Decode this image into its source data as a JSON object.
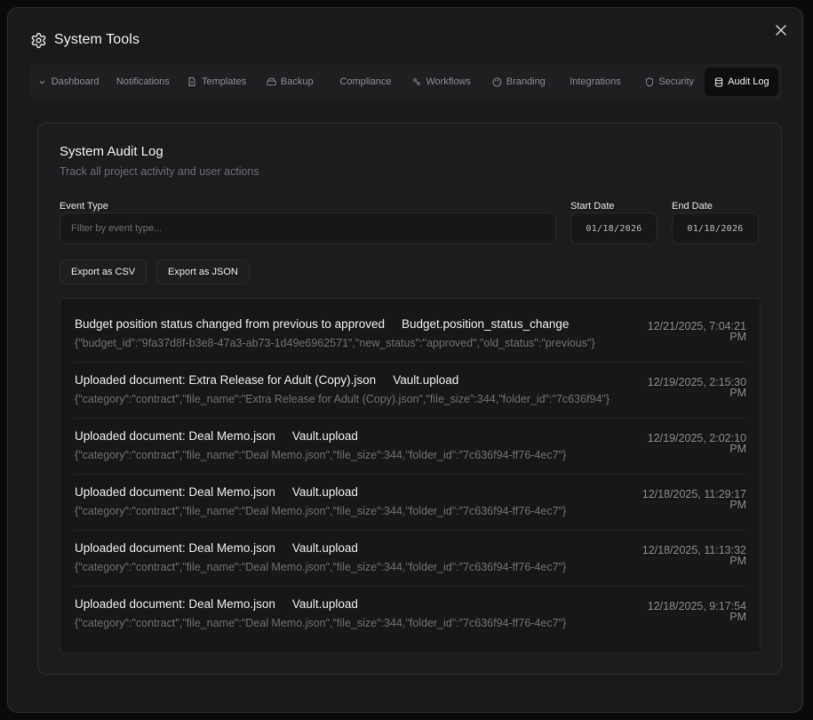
{
  "window": {
    "title": "System Tools"
  },
  "tabs": [
    {
      "label": "Dashboard",
      "icon": "dashboard-icon"
    },
    {
      "label": "Notifications",
      "icon": ""
    },
    {
      "label": "Templates",
      "icon": "document-icon"
    },
    {
      "label": "Backup",
      "icon": "hard-drive-icon"
    },
    {
      "label": "Compliance",
      "icon": ""
    },
    {
      "label": "Workflows",
      "icon": "workflow-icon"
    },
    {
      "label": "Branding",
      "icon": "palette-icon"
    },
    {
      "label": "Integrations",
      "icon": ""
    },
    {
      "label": "Security",
      "icon": "shield-icon"
    },
    {
      "label": "Audit Log",
      "icon": "database-icon",
      "active": true
    }
  ],
  "audit": {
    "title": "System Audit Log",
    "subtitle": "Track all project activity and user actions",
    "filters": {
      "event_type_label": "Event Type",
      "event_type_placeholder": "Filter by event type...",
      "start_label": "Start Date",
      "start_value": "01/18/2026",
      "end_label": "End Date",
      "end_value": "01/18/2026"
    },
    "export_csv": "Export as CSV",
    "export_json": "Export as JSON",
    "entries": [
      {
        "description": "Budget position status changed from previous to approved",
        "event": "Budget.position_status_change",
        "payload": "{\"budget_id\":\"9fa37d8f-b3e8-47a3-ab73-1d49e6962571\",\"new_status\":\"approved\",\"old_status\":\"previous\"}",
        "time": "12/21/2025, 7:04:21 PM"
      },
      {
        "description": "Uploaded document: Extra Release for Adult (Copy).json",
        "event": "Vault.upload",
        "payload": "{\"category\":\"contract\",\"file_name\":\"Extra Release for Adult (Copy).json\",\"file_size\":344,\"folder_id\":\"7c636f94\"}",
        "time": "12/19/2025, 2:15:30 PM"
      },
      {
        "description": "Uploaded document: Deal Memo.json",
        "event": "Vault.upload",
        "payload": "{\"category\":\"contract\",\"file_name\":\"Deal Memo.json\",\"file_size\":344,\"folder_id\":\"7c636f94-ff76-4ec7\"}",
        "time": "12/19/2025, 2:02:10 PM"
      },
      {
        "description": "Uploaded document: Deal Memo.json",
        "event": "Vault.upload",
        "payload": "{\"category\":\"contract\",\"file_name\":\"Deal Memo.json\",\"file_size\":344,\"folder_id\":\"7c636f94-ff76-4ec7\"}",
        "time": "12/18/2025, 11:29:17 PM"
      },
      {
        "description": "Uploaded document: Deal Memo.json",
        "event": "Vault.upload",
        "payload": "{\"category\":\"contract\",\"file_name\":\"Deal Memo.json\",\"file_size\":344,\"folder_id\":\"7c636f94-ff76-4ec7\"}",
        "time": "12/18/2025, 11:13:32 PM"
      },
      {
        "description": "Uploaded document: Deal Memo.json",
        "event": "Vault.upload",
        "payload": "{\"category\":\"contract\",\"file_name\":\"Deal Memo.json\",\"file_size\":344,\"folder_id\":\"7c636f94-ff76-4ec7\"}",
        "time": "12/18/2025, 9:17:54 PM"
      }
    ]
  }
}
